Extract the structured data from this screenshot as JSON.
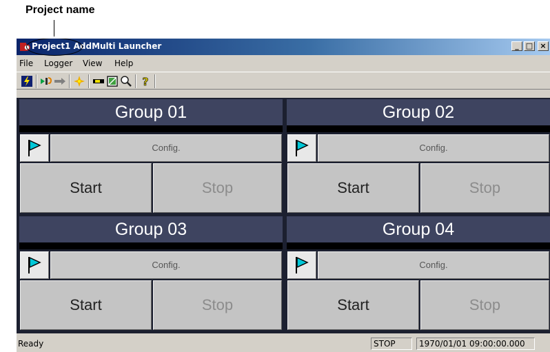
{
  "annotation": {
    "callout_label": "Project name"
  },
  "window": {
    "project_name": "Project1",
    "app_name": "AddMulti Launcher",
    "minimize_label": "_",
    "maximize_label": "□",
    "close_label": "×"
  },
  "menu": [
    "File",
    "Logger",
    "View",
    "Help"
  ],
  "toolbar": {
    "icons": [
      "lightning-icon",
      "connect-icon",
      "disconnect-icon",
      "sparkle-icon",
      "meter-icon",
      "monitor-icon",
      "zoom-icon",
      "help-icon"
    ],
    "help_glyph": "?"
  },
  "groups": [
    {
      "title": "Group 01",
      "config_label": "Config.",
      "start_label": "Start",
      "stop_label": "Stop"
    },
    {
      "title": "Group 02",
      "config_label": "Config.",
      "start_label": "Start",
      "stop_label": "Stop"
    },
    {
      "title": "Group 03",
      "config_label": "Config.",
      "start_label": "Start",
      "stop_label": "Stop"
    },
    {
      "title": "Group 04",
      "config_label": "Config.",
      "start_label": "Start",
      "stop_label": "Stop"
    }
  ],
  "status": {
    "ready": "Ready",
    "state": "STOP",
    "datetime": "1970/01/01 09:00:00.000"
  },
  "colors": {
    "flag": "#00c8d8",
    "group_header": "#3e4460",
    "titlebar_start": "#0a246a",
    "titlebar_end": "#a6caf0"
  }
}
